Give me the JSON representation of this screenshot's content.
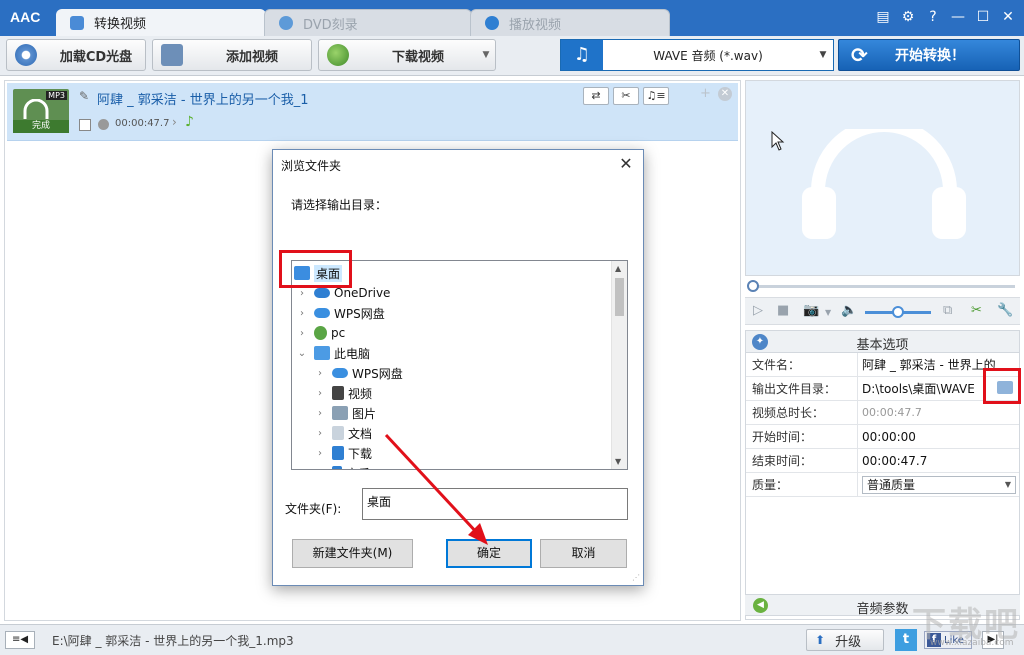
{
  "app": {
    "logo": "AAC"
  },
  "tabs": [
    {
      "label": "转换视频",
      "active": true
    },
    {
      "label": "DVD刻录",
      "active": false
    },
    {
      "label": "播放视频",
      "active": false
    }
  ],
  "window_controls": [
    "settings",
    "help",
    "minimize",
    "maximize",
    "close"
  ],
  "toolbar": {
    "load_cd": "加载CD光盘",
    "add_video": "添加视频",
    "download_video": "下载视频",
    "output_format": "WAVE 音频 (*.wav)",
    "start_convert": "开始转换！"
  },
  "file_list": {
    "items": [
      {
        "name": "阿肆 _ 郭采洁 - 世界上的另一个我_1",
        "format_badge": "MP3",
        "status": "完成",
        "duration": "00:00:47.7"
      }
    ]
  },
  "properties": {
    "section_title": "基本选项",
    "rows": [
      {
        "key": "文件名：",
        "value": "阿肆 _ 郭采洁 - 世界上的"
      },
      {
        "key": "输出文件目录：",
        "value": "D:\\tools\\桌面\\WAVE"
      },
      {
        "key": "视频总时长：",
        "value": "00:00:47.7"
      },
      {
        "key": "开始时间：",
        "value": "00:00:00"
      },
      {
        "key": "结束时间：",
        "value": "00:00:47.7"
      },
      {
        "key": "质量：",
        "value": "普通质量"
      }
    ],
    "audio_section": "音频参数"
  },
  "player": {
    "volume_fraction": 0.5,
    "position_fraction": 0.0
  },
  "statusbar": {
    "path": "E:\\阿肆 _ 郭采洁 - 世界上的另一个我_1.mp3",
    "upgrade": "升级",
    "like": "Like"
  },
  "dialog": {
    "title": "浏览文件夹",
    "prompt": "请选择输出目录：",
    "tree": [
      {
        "label": "桌面",
        "level": 0,
        "selected": true,
        "icon": "desktop-icon"
      },
      {
        "label": "OneDrive",
        "level": 1,
        "icon": "cloud-icon"
      },
      {
        "label": "WPS网盘",
        "level": 1,
        "icon": "cloud-icon"
      },
      {
        "label": "pc",
        "level": 1,
        "icon": "user-icon"
      },
      {
        "label": "此电脑",
        "level": 1,
        "expanded": true,
        "icon": "computer-icon"
      },
      {
        "label": "WPS网盘",
        "level": 2,
        "icon": "cloud-icon"
      },
      {
        "label": "视频",
        "level": 2,
        "icon": "film-icon"
      },
      {
        "label": "图片",
        "level": 2,
        "icon": "picture-icon"
      },
      {
        "label": "文档",
        "level": 2,
        "icon": "document-icon"
      },
      {
        "label": "下载",
        "level": 2,
        "icon": "download-icon"
      },
      {
        "label": "音乐",
        "level": 2,
        "icon": "music-icon"
      }
    ],
    "folder_label": "文件夹(F):",
    "folder_value": "桌面",
    "new_folder": "新建文件夹(M)",
    "ok": "确定",
    "cancel": "取消"
  },
  "watermark": {
    "text": "下载吧",
    "url": "www.xiazaiba.com"
  },
  "colors": {
    "accent": "#2b6fc2",
    "annotation": "#e1101a",
    "selection": "#cce8ff"
  }
}
